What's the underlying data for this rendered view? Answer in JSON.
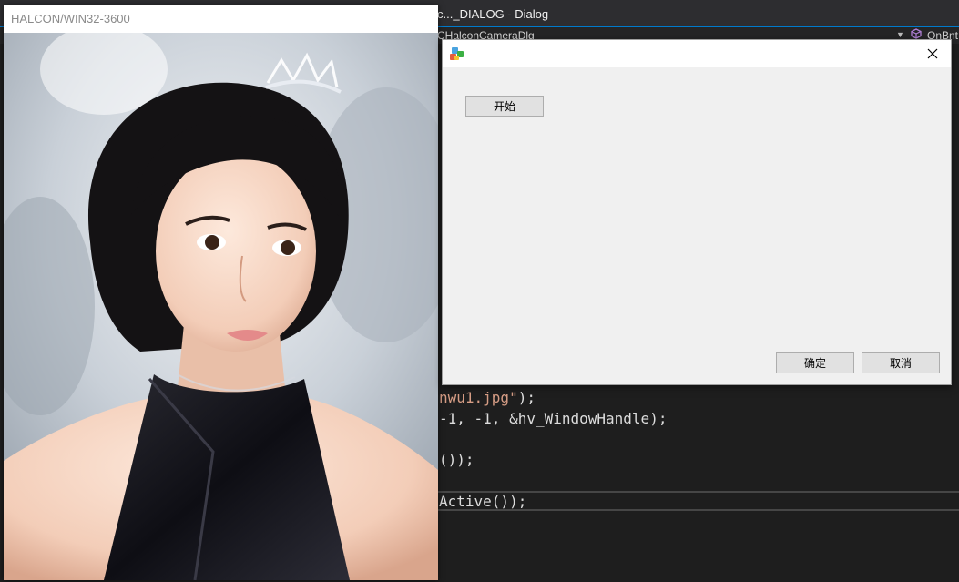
{
  "ide": {
    "title": "c..._DIALOG - Dialog",
    "class_dropdown": "CHalconCameraDlg",
    "member_dropdown": "OnBnt",
    "code_lines": [
      {
        "pre": "",
        "str": "nwu1.jpg\"",
        "post": ");"
      },
      {
        "pre": "-1, -1, &hv_WindowHandle);",
        "str": "",
        "post": ""
      },
      {
        "pre": "());",
        "str": "",
        "post": ""
      },
      {
        "pre": "Active());",
        "str": "",
        "post": ""
      }
    ]
  },
  "halcon_window": {
    "title": "HALCON/WIN32-3600"
  },
  "dialog": {
    "start_button": "开始",
    "ok_button": "确定",
    "cancel_button": "取消"
  },
  "colors": {
    "ide_bg": "#1e1e1e",
    "accent": "#007acc",
    "dialog_bg": "#f0f0f0",
    "button_bg": "#e1e1e1",
    "string_color": "#d69d85"
  }
}
